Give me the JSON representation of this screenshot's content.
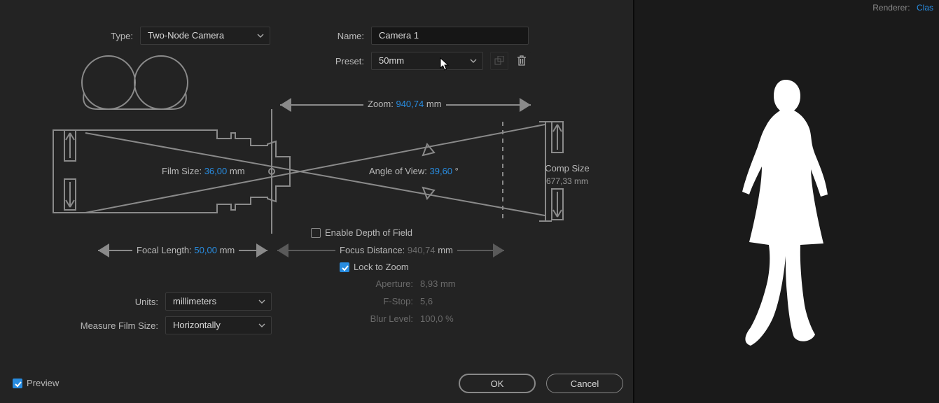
{
  "header": {
    "type_label": "Type:",
    "type_value": "Two-Node Camera",
    "name_label": "Name:",
    "name_value": "Camera 1",
    "preset_label": "Preset:",
    "preset_value": "50mm"
  },
  "diagram": {
    "film_size_label": "Film Size:",
    "film_size_value": "36,00",
    "film_size_unit": "mm",
    "focal_length_label": "Focal Length:",
    "focal_length_value": "50,00",
    "focal_length_unit": "mm",
    "zoom_label": "Zoom:",
    "zoom_value": "940,74",
    "zoom_unit": "mm",
    "angle_label": "Angle of View:",
    "angle_value": "39,60",
    "angle_unit": "°",
    "comp_size_label": "Comp Size",
    "comp_size_value": "677,33 mm"
  },
  "dof": {
    "enable_label": "Enable Depth of Field",
    "enable_checked": false,
    "focus_distance_label": "Focus Distance:",
    "focus_distance_value": "940,74",
    "focus_distance_unit": "mm",
    "lock_label": "Lock to Zoom",
    "lock_checked": true,
    "aperture_label": "Aperture:",
    "aperture_value": "8,93",
    "aperture_unit": "mm",
    "fstop_label": "F-Stop:",
    "fstop_value": "5,6",
    "blur_label": "Blur Level:",
    "blur_value": "100,0",
    "blur_unit": "%"
  },
  "units": {
    "units_label": "Units:",
    "units_value": "millimeters",
    "measure_label": "Measure Film Size:",
    "measure_value": "Horizontally"
  },
  "footer": {
    "preview_label": "Preview",
    "preview_checked": true,
    "ok_label": "OK",
    "cancel_label": "Cancel"
  },
  "sidepanel": {
    "renderer_label": "Renderer:",
    "renderer_value": "Clas"
  }
}
